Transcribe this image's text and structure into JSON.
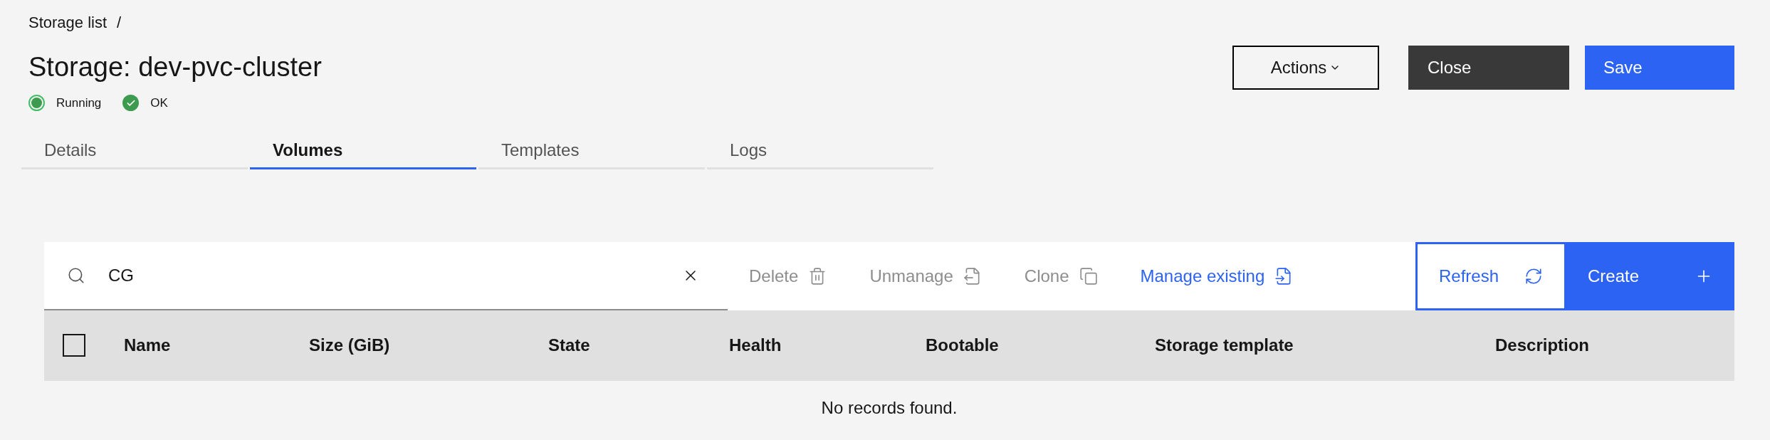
{
  "breadcrumb": {
    "items": [
      "Storage list"
    ],
    "separator": "/"
  },
  "title": "Storage: dev-pvc-cluster",
  "statuses": [
    {
      "label": "Running",
      "kind": "running"
    },
    {
      "label": "OK",
      "kind": "ok"
    }
  ],
  "header_buttons": [
    {
      "label": "Actions",
      "kind": "menu"
    },
    {
      "label": "Close",
      "kind": "dark"
    },
    {
      "label": "Save",
      "kind": "primary"
    }
  ],
  "tabs": [
    {
      "label": "Details",
      "selected": false
    },
    {
      "label": "Volumes",
      "selected": true
    },
    {
      "label": "Templates",
      "selected": false
    },
    {
      "label": "Logs",
      "selected": false
    }
  ],
  "toolbar": {
    "search": {
      "value": "CG"
    },
    "actions": [
      {
        "label": "Delete",
        "kind": "delete",
        "disabled": true
      },
      {
        "label": "Unmanage",
        "kind": "unmanage",
        "disabled": true
      },
      {
        "label": "Clone",
        "kind": "clone",
        "disabled": true
      },
      {
        "label": "Manage existing",
        "kind": "manage",
        "disabled": false
      }
    ],
    "buttons": [
      {
        "label": "Refresh",
        "kind": "refresh"
      },
      {
        "label": "Create",
        "kind": "create"
      }
    ]
  },
  "table": {
    "select_all": {
      "checked": false
    },
    "columns": [
      "Name",
      "Size (GiB)",
      "State",
      "Health",
      "Bootable",
      "Storage template",
      "Description"
    ],
    "empty_message": "No records found."
  }
}
